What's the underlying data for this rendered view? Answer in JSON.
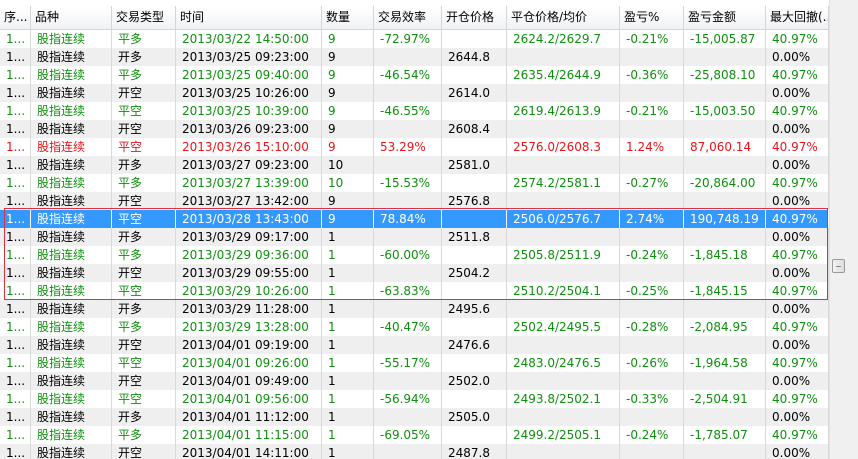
{
  "headers": [
    "序...",
    "品种",
    "交易类型",
    "时间",
    "数量",
    "交易效率",
    "开仓价格",
    "平仓价格/均价",
    "盈亏%",
    "盈亏金额",
    "最大回撤(..."
  ],
  "rows": [
    {
      "seq": "1...",
      "symbol": "股指连续",
      "type": "平多",
      "time": "2013/03/22 14:50:00",
      "qty": "9",
      "eff": "-72.97%",
      "open": "",
      "close": "2624.2/2629.7",
      "pnl_pct": "-0.21%",
      "pnl_amt": "-15,005.87",
      "dd": "40.97%",
      "color": "green"
    },
    {
      "seq": "1...",
      "symbol": "股指连续",
      "type": "开多",
      "time": "2013/03/25 09:23:00",
      "qty": "9",
      "eff": "",
      "open": "2644.8",
      "close": "",
      "pnl_pct": "",
      "pnl_amt": "",
      "dd": "0.00%",
      "color": "black"
    },
    {
      "seq": "1...",
      "symbol": "股指连续",
      "type": "平多",
      "time": "2013/03/25 09:40:00",
      "qty": "9",
      "eff": "-46.54%",
      "open": "",
      "close": "2635.4/2644.9",
      "pnl_pct": "-0.36%",
      "pnl_amt": "-25,808.10",
      "dd": "40.97%",
      "color": "green"
    },
    {
      "seq": "1...",
      "symbol": "股指连续",
      "type": "开空",
      "time": "2013/03/25 10:26:00",
      "qty": "9",
      "eff": "",
      "open": "2614.0",
      "close": "",
      "pnl_pct": "",
      "pnl_amt": "",
      "dd": "0.00%",
      "color": "black"
    },
    {
      "seq": "1...",
      "symbol": "股指连续",
      "type": "平空",
      "time": "2013/03/25 10:39:00",
      "qty": "9",
      "eff": "-46.55%",
      "open": "",
      "close": "2619.4/2613.9",
      "pnl_pct": "-0.21%",
      "pnl_amt": "-15,003.50",
      "dd": "40.97%",
      "color": "green"
    },
    {
      "seq": "1...",
      "symbol": "股指连续",
      "type": "开空",
      "time": "2013/03/26 09:23:00",
      "qty": "9",
      "eff": "",
      "open": "2608.4",
      "close": "",
      "pnl_pct": "",
      "pnl_amt": "",
      "dd": "0.00%",
      "color": "black"
    },
    {
      "seq": "1...",
      "symbol": "股指连续",
      "type": "平空",
      "time": "2013/03/26 15:10:00",
      "qty": "9",
      "eff": "53.29%",
      "open": "",
      "close": "2576.0/2608.3",
      "pnl_pct": "1.24%",
      "pnl_amt": "87,060.14",
      "dd": "40.97%",
      "color": "red"
    },
    {
      "seq": "1...",
      "symbol": "股指连续",
      "type": "开多",
      "time": "2013/03/27 09:23:00",
      "qty": "10",
      "eff": "",
      "open": "2581.0",
      "close": "",
      "pnl_pct": "",
      "pnl_amt": "",
      "dd": "0.00%",
      "color": "black"
    },
    {
      "seq": "1...",
      "symbol": "股指连续",
      "type": "平多",
      "time": "2013/03/27 13:39:00",
      "qty": "10",
      "eff": "-15.53%",
      "open": "",
      "close": "2574.2/2581.1",
      "pnl_pct": "-0.27%",
      "pnl_amt": "-20,864.00",
      "dd": "40.97%",
      "color": "green"
    },
    {
      "seq": "1...",
      "symbol": "股指连续",
      "type": "开空",
      "time": "2013/03/27 13:42:00",
      "qty": "9",
      "eff": "",
      "open": "2576.8",
      "close": "",
      "pnl_pct": "",
      "pnl_amt": "",
      "dd": "0.00%",
      "color": "black"
    },
    {
      "seq": "1...",
      "symbol": "股指连续",
      "type": "平空",
      "time": "2013/03/28 13:43:00",
      "qty": "9",
      "eff": "78.84%",
      "open": "",
      "close": "2506.0/2576.7",
      "pnl_pct": "2.74%",
      "pnl_amt": "190,748.19",
      "dd": "40.97%",
      "color": "sel"
    },
    {
      "seq": "1...",
      "symbol": "股指连续",
      "type": "开多",
      "time": "2013/03/29 09:17:00",
      "qty": "1",
      "eff": "",
      "open": "2511.8",
      "close": "",
      "pnl_pct": "",
      "pnl_amt": "",
      "dd": "0.00%",
      "color": "black"
    },
    {
      "seq": "1...",
      "symbol": "股指连续",
      "type": "平多",
      "time": "2013/03/29 09:36:00",
      "qty": "1",
      "eff": "-60.00%",
      "open": "",
      "close": "2505.8/2511.9",
      "pnl_pct": "-0.24%",
      "pnl_amt": "-1,845.18",
      "dd": "40.97%",
      "color": "green"
    },
    {
      "seq": "1...",
      "symbol": "股指连续",
      "type": "开空",
      "time": "2013/03/29 09:55:00",
      "qty": "1",
      "eff": "",
      "open": "2504.2",
      "close": "",
      "pnl_pct": "",
      "pnl_amt": "",
      "dd": "0.00%",
      "color": "black"
    },
    {
      "seq": "1...",
      "symbol": "股指连续",
      "type": "平空",
      "time": "2013/03/29 10:26:00",
      "qty": "1",
      "eff": "-63.83%",
      "open": "",
      "close": "2510.2/2504.1",
      "pnl_pct": "-0.25%",
      "pnl_amt": "-1,845.15",
      "dd": "40.97%",
      "color": "green"
    },
    {
      "seq": "1...",
      "symbol": "股指连续",
      "type": "开多",
      "time": "2013/03/29 11:28:00",
      "qty": "1",
      "eff": "",
      "open": "2495.6",
      "close": "",
      "pnl_pct": "",
      "pnl_amt": "",
      "dd": "0.00%",
      "color": "black"
    },
    {
      "seq": "1...",
      "symbol": "股指连续",
      "type": "平多",
      "time": "2013/03/29 13:28:00",
      "qty": "1",
      "eff": "-40.47%",
      "open": "",
      "close": "2502.4/2495.5",
      "pnl_pct": "-0.28%",
      "pnl_amt": "-2,084.95",
      "dd": "40.97%",
      "color": "green"
    },
    {
      "seq": "1...",
      "symbol": "股指连续",
      "type": "开空",
      "time": "2013/04/01 09:19:00",
      "qty": "1",
      "eff": "",
      "open": "2476.6",
      "close": "",
      "pnl_pct": "",
      "pnl_amt": "",
      "dd": "0.00%",
      "color": "black"
    },
    {
      "seq": "1...",
      "symbol": "股指连续",
      "type": "平空",
      "time": "2013/04/01 09:26:00",
      "qty": "1",
      "eff": "-55.17%",
      "open": "",
      "close": "2483.0/2476.5",
      "pnl_pct": "-0.26%",
      "pnl_amt": "-1,964.58",
      "dd": "40.97%",
      "color": "green"
    },
    {
      "seq": "1...",
      "symbol": "股指连续",
      "type": "开空",
      "time": "2013/04/01 09:49:00",
      "qty": "1",
      "eff": "",
      "open": "2502.0",
      "close": "",
      "pnl_pct": "",
      "pnl_amt": "",
      "dd": "0.00%",
      "color": "black"
    },
    {
      "seq": "1...",
      "symbol": "股指连续",
      "type": "平空",
      "time": "2013/04/01 09:56:00",
      "qty": "1",
      "eff": "-56.94%",
      "open": "",
      "close": "2493.8/2502.1",
      "pnl_pct": "-0.33%",
      "pnl_amt": "-2,504.91",
      "dd": "40.97%",
      "color": "green"
    },
    {
      "seq": "1...",
      "symbol": "股指连续",
      "type": "开多",
      "time": "2013/04/01 11:12:00",
      "qty": "1",
      "eff": "",
      "open": "2505.0",
      "close": "",
      "pnl_pct": "",
      "pnl_amt": "",
      "dd": "0.00%",
      "color": "black"
    },
    {
      "seq": "1...",
      "symbol": "股指连续",
      "type": "平多",
      "time": "2013/04/01 11:15:00",
      "qty": "1",
      "eff": "-69.05%",
      "open": "",
      "close": "2499.2/2505.1",
      "pnl_pct": "-0.24%",
      "pnl_amt": "-1,785.07",
      "dd": "40.97%",
      "color": "green"
    },
    {
      "seq": "1...",
      "symbol": "股指连续",
      "type": "开空",
      "time": "2013/04/01 14:11:00",
      "qty": "1",
      "eff": "",
      "open": "2487.8",
      "close": "",
      "pnl_pct": "",
      "pnl_amt": "",
      "dd": "0.00%",
      "color": "black"
    }
  ],
  "colors": {
    "profit": "#e8141a",
    "loss": "#0f8f0f",
    "selected_row": "#3399ff",
    "alt_row": "#efefef",
    "highlight_border": "#d9333f"
  },
  "icons": {
    "scrollbar_thumb": "scroll-thumb-grip-icon"
  }
}
